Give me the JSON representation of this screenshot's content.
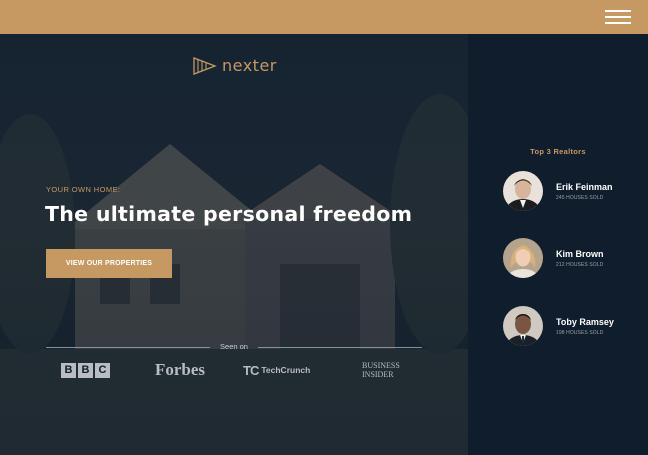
{
  "brand": {
    "name": "nexter",
    "accent_color": "#c69963",
    "dark_color": "#101d2c",
    "logo_icon": "triangle-play-logo-icon"
  },
  "topbar": {
    "menu_icon": "hamburger-menu-icon"
  },
  "hero": {
    "eyebrow": "Your own home:",
    "headline": "The ultimate personal freedom",
    "cta_label": "View our properties"
  },
  "seen_on": {
    "label": "Seen on",
    "logos": [
      {
        "name": "BBC",
        "letters": [
          "B",
          "B",
          "C"
        ]
      },
      {
        "name": "Forbes"
      },
      {
        "name": "TechCrunch",
        "mark": "TC"
      },
      {
        "name": "Business Insider",
        "lines": [
          "BUSINESS",
          "INSIDER"
        ]
      }
    ]
  },
  "realtors": {
    "title": "Top 3 Realtors",
    "items": [
      {
        "name": "Erik Feinman",
        "sold": "245 houses sold"
      },
      {
        "name": "Kim Brown",
        "sold": "212 houses sold"
      },
      {
        "name": "Toby Ramsey",
        "sold": "198 houses sold"
      }
    ]
  }
}
